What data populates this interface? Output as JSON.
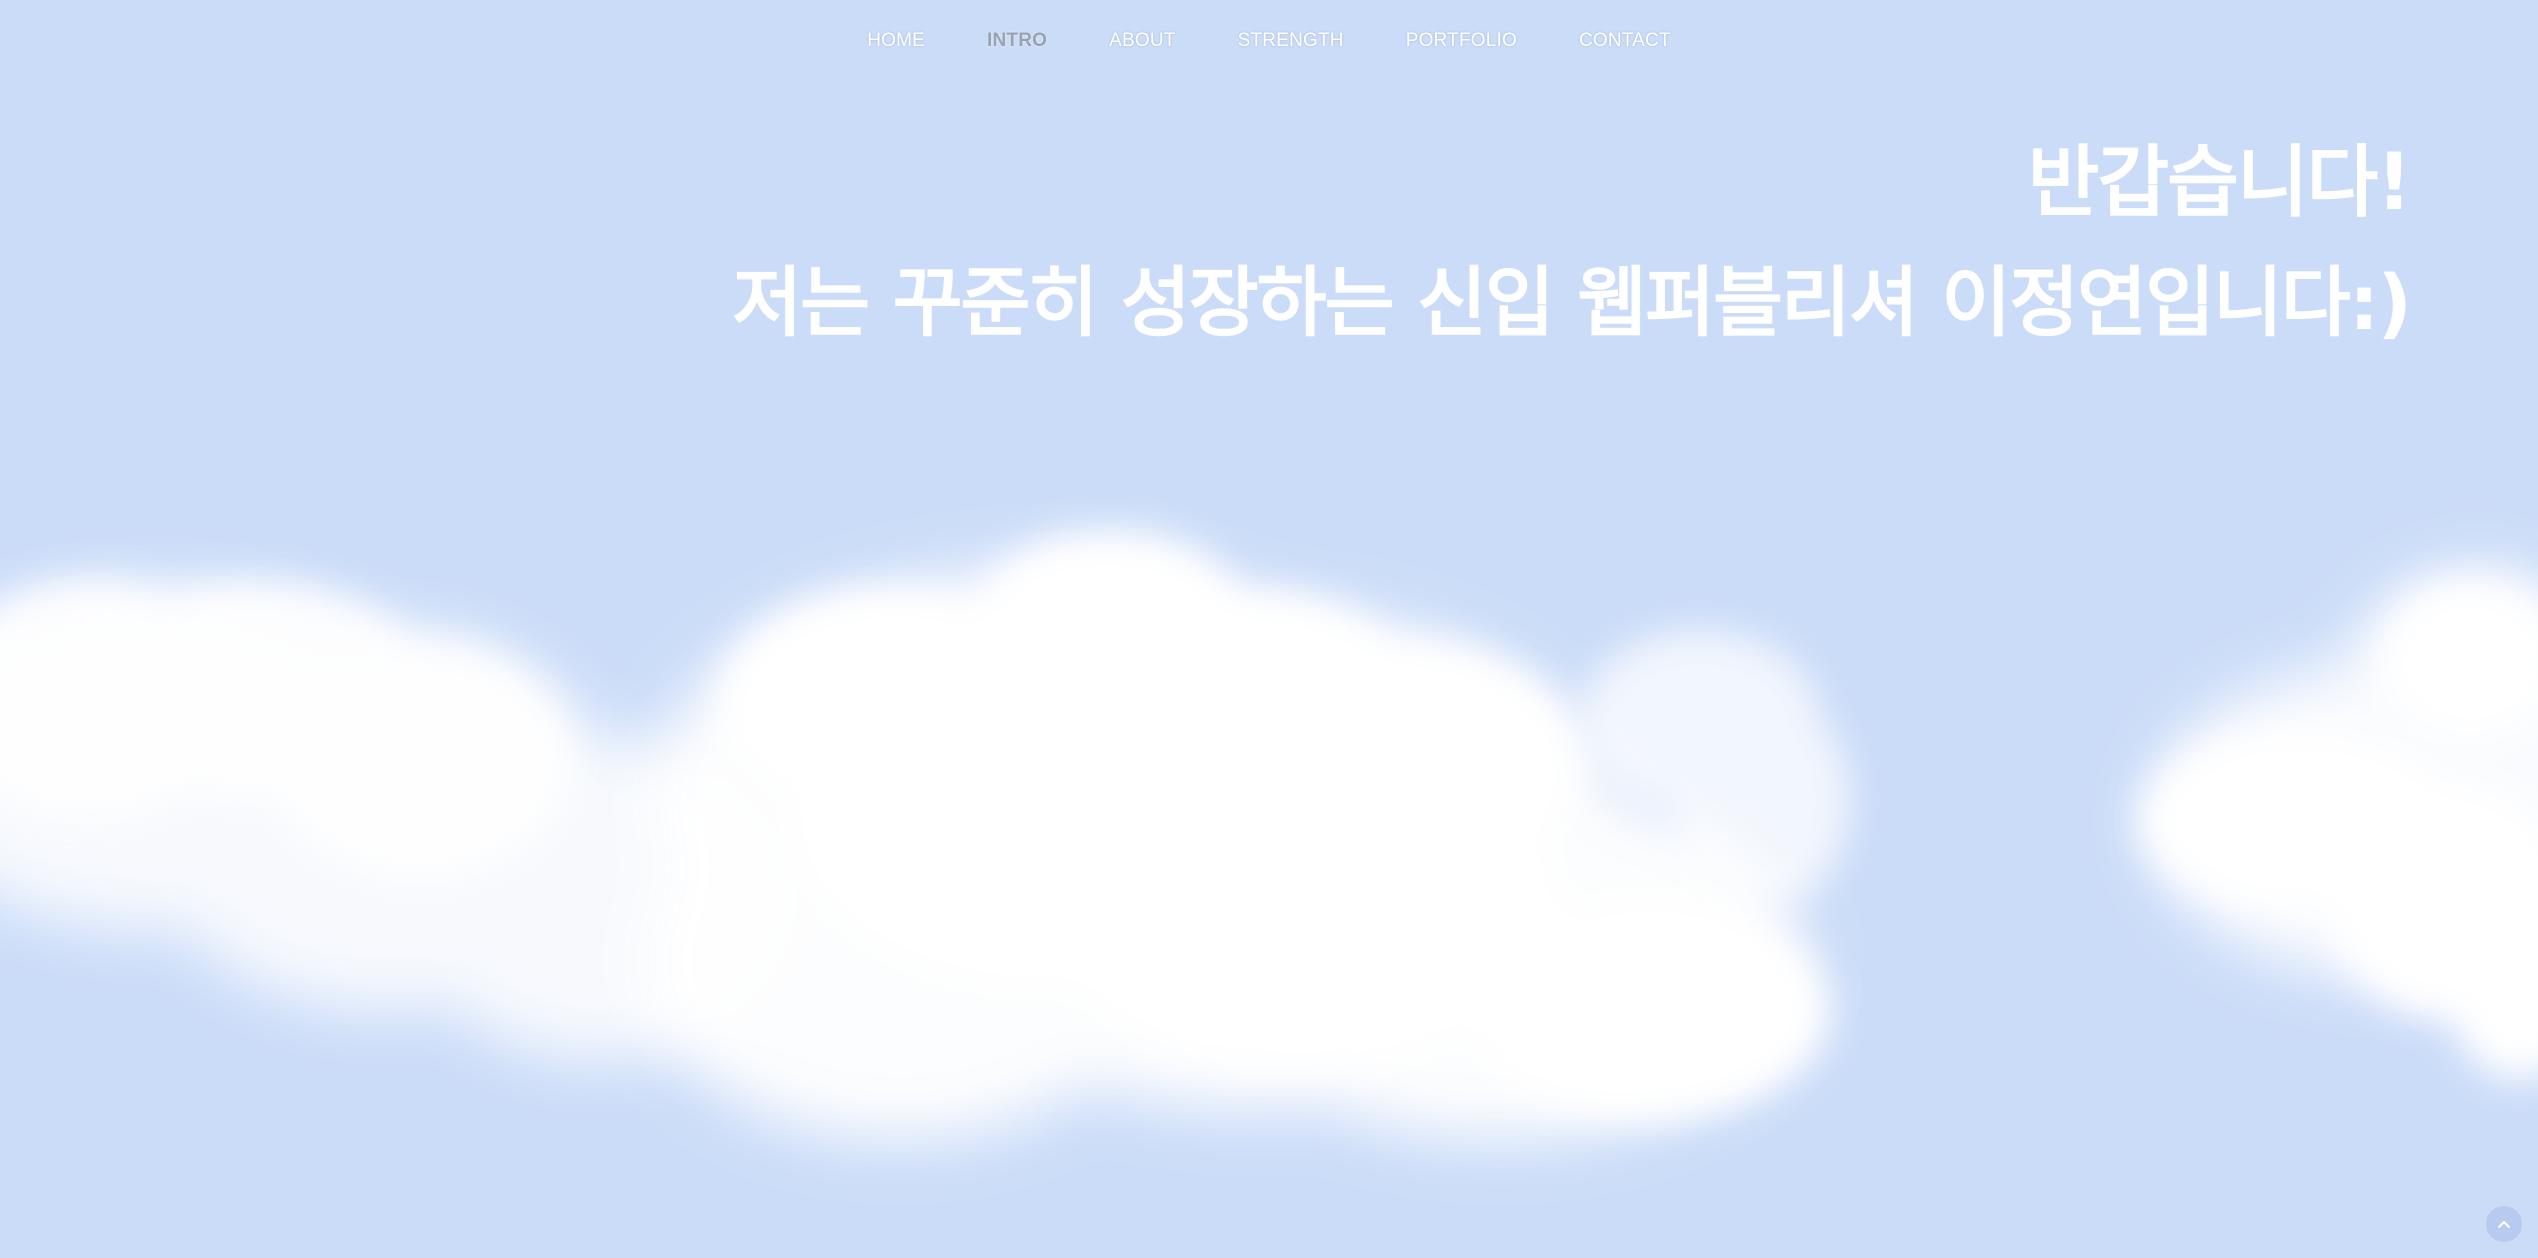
{
  "nav": {
    "items": [
      {
        "label": "HOME",
        "active": false
      },
      {
        "label": "INTRO",
        "active": true
      },
      {
        "label": "ABOUT",
        "active": false
      },
      {
        "label": "STRENGTH",
        "active": false
      },
      {
        "label": "PORTFOLIO",
        "active": false
      },
      {
        "label": "CONTACT",
        "active": false
      }
    ]
  },
  "hero": {
    "greeting": "반갑습니다!",
    "intro": "저는 꾸준히 성장하는 신입 웹퍼블리셔 이정연입니다:)"
  },
  "scroll_top": {
    "icon": "chevron-up-icon"
  },
  "colors": {
    "sky": "#cbdcf8",
    "text": "#ffffff",
    "active_nav": "#9aa2ad"
  }
}
